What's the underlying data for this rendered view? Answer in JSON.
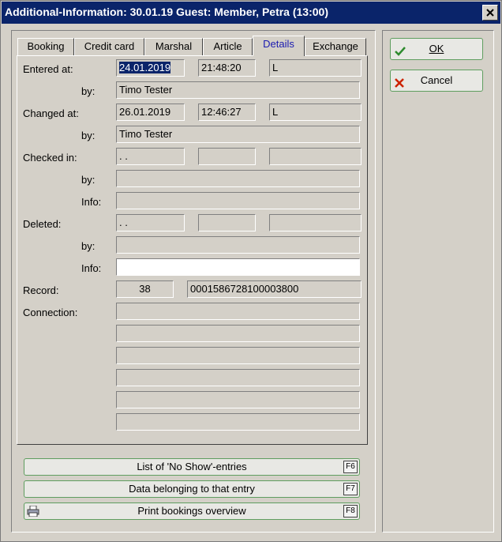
{
  "window": {
    "title": "Additional-Information: 30.01.19 Guest: Member, Petra (13:00)"
  },
  "tabs": [
    {
      "label": "Booking"
    },
    {
      "label": "Credit card"
    },
    {
      "label": "Marshal"
    },
    {
      "label": "Article"
    },
    {
      "label": "Details",
      "active": true
    },
    {
      "label": "Exchange"
    }
  ],
  "labels": {
    "entered_at": "Entered at:",
    "by": "by:",
    "changed_at": "Changed at:",
    "checked_in": "Checked in:",
    "info": "Info:",
    "deleted": "Deleted:",
    "record": "Record:",
    "connection": "Connection:"
  },
  "entered": {
    "date": "24.01.2019",
    "time": "21:48:20",
    "flag": "L",
    "by": "Timo Tester"
  },
  "changed": {
    "date": "26.01.2019",
    "time": "12:46:27",
    "flag": "L",
    "by": "Timo Tester"
  },
  "checked_in": {
    "date": " . .",
    "time": "",
    "flag": "",
    "by": "",
    "info": ""
  },
  "deleted": {
    "date": " . .",
    "time": "",
    "flag": "",
    "by": "",
    "info": ""
  },
  "record": {
    "number": "38",
    "id": "0001586728100003800"
  },
  "connections": [
    "",
    "",
    "",
    "",
    "",
    ""
  ],
  "buttons": {
    "no_show": {
      "label": "List of 'No Show'-entries",
      "key": "F6"
    },
    "data_belonging": {
      "label": "Data belonging to that entry",
      "key": "F7"
    },
    "print_overview": {
      "label": "Print bookings overview",
      "key": "F8"
    },
    "ok": "OK",
    "cancel": "Cancel"
  },
  "colors": {
    "title_bar": "#0a246a",
    "ok_check": "#2e8b2e",
    "cancel_x": "#cc2200",
    "active_tab_text": "#1a1ab0"
  }
}
